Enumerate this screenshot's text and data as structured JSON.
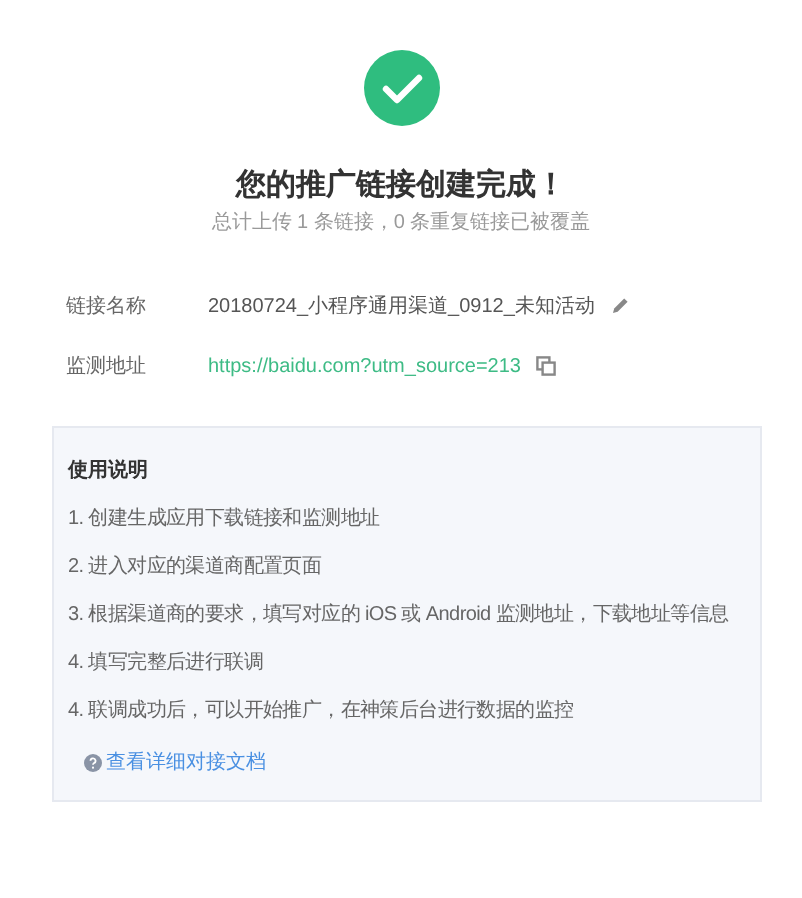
{
  "title": "您的推广链接创建完成！",
  "subtitle": "总计上传 1 条链接，0 条重复链接已被覆盖",
  "fields": [
    {
      "kind": "name",
      "label": "链接名称",
      "value": "20180724_小程序通用渠道_0912_未知活动"
    },
    {
      "kind": "url",
      "label": "监测地址",
      "value": "https://baidu.com?utm_source=213"
    }
  ],
  "instructions": {
    "heading": "使用说明",
    "steps": [
      "1. 创建生成应用下载链接和监测地址",
      "2. 进入对应的渠道商配置页面",
      "3. 根据渠道商的要求，填写对应的 iOS 或 Android 监测地址，下载地址等信息",
      "4. 填写完整后进行联调",
      "4. 联调成功后，可以开始推广，在神策后台进行数据的监控"
    ],
    "link": "查看详细对接文档"
  }
}
